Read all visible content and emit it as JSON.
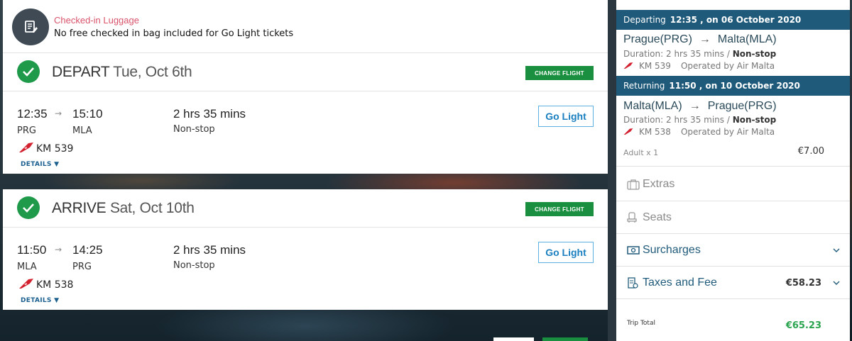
{
  "luggage": {
    "title": "Checked-in Luggage",
    "text": "No free checked in bag included for Go Light tickets"
  },
  "depart": {
    "direction": "DEPART",
    "date": "Tue, Oct 6th",
    "change_label": "CHANGE FLIGHT",
    "dep_time": "12:35",
    "arr_time": "15:10",
    "dep_code": "PRG",
    "arr_code": "MLA",
    "duration": "2 hrs 35 mins",
    "stops": "Non-stop",
    "flight_no": "KM 539",
    "details_label": "DETAILS",
    "fare_label": "Go Light"
  },
  "arrive": {
    "direction": "ARRIVE",
    "date": "Sat, Oct 10th",
    "change_label": "CHANGE FLIGHT",
    "dep_time": "11:50",
    "arr_time": "14:25",
    "dep_code": "MLA",
    "arr_code": "PRG",
    "duration": "2 hrs 35 mins",
    "stops": "Non-stop",
    "flight_no": "KM 538",
    "details_label": "DETAILS",
    "fare_label": "Go Light"
  },
  "summary": {
    "departing": {
      "label": "Departing",
      "when": "12:35 , on 06 October 2020",
      "from": "Prague(PRG)",
      "to": "Malta(MLA)",
      "duration_label": "Duration:",
      "duration": "2 hrs 35 mins /",
      "stops": "Non-stop",
      "flight_no": "KM 539",
      "operated": "Operated by Air Malta"
    },
    "returning": {
      "label": "Returning",
      "when": "11:50 , on 10 October 2020",
      "from": "Malta(MLA)",
      "to": "Prague(PRG)",
      "duration_label": "Duration:",
      "duration": "2 hrs 35 mins /",
      "stops": "Non-stop",
      "flight_no": "KM 538",
      "operated": "Operated by Air Malta"
    },
    "passengers": "Adult x 1",
    "passenger_price": "€7.00",
    "extras_label": "Extras",
    "seats_label": "Seats",
    "surcharges_label": "Surcharges",
    "taxes_label": "Taxes and Fee",
    "taxes_value": "€58.23",
    "trip_total_label": "Trip Total",
    "trip_total_value": "€65.23"
  },
  "colors": {
    "header_blue": "#1f5a7a",
    "success_green": "#1a8f3f",
    "link_blue": "#1a7fc0",
    "luggage_pink": "#d9536b"
  }
}
